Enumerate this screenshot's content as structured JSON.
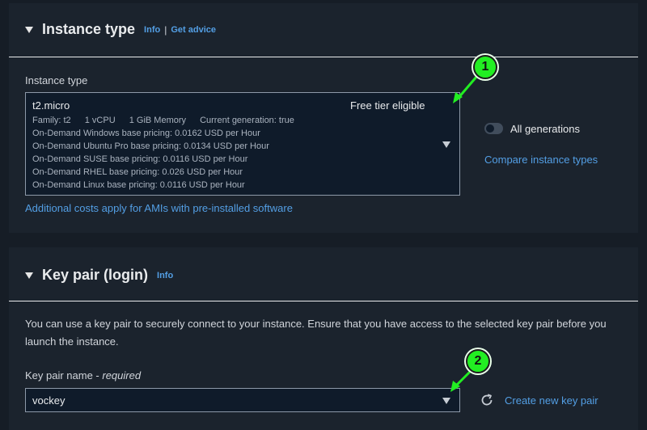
{
  "instance_section": {
    "title": "Instance type",
    "info_link": "Info",
    "separator": "|",
    "advice_link": "Get advice",
    "field_label": "Instance type",
    "selected": {
      "name": "t2.micro",
      "free_tier": "Free tier eligible",
      "family": "Family: t2",
      "vcpu": "1 vCPU",
      "memory": "1 GiB Memory",
      "generation": "Current generation: true",
      "pricing": [
        "On-Demand Windows base pricing: 0.0162 USD per Hour",
        "On-Demand Ubuntu Pro base pricing: 0.0134 USD per Hour",
        "On-Demand SUSE base pricing: 0.0116 USD per Hour",
        "On-Demand RHEL base pricing: 0.026 USD per Hour",
        "On-Demand Linux base pricing: 0.0116 USD per Hour"
      ]
    },
    "toggle_label": "All generations",
    "compare_link": "Compare instance types",
    "ami_costs_link": "Additional costs apply for AMIs with pre-installed software"
  },
  "keypair_section": {
    "title": "Key pair (login)",
    "info_link": "Info",
    "description": "You can use a key pair to securely connect to your instance. Ensure that you have access to the selected key pair before you launch the instance.",
    "field_label": "Key pair name - ",
    "field_required": "required",
    "selected_value": "vockey",
    "create_link": "Create new key pair"
  },
  "annotations": {
    "badge_1": "1",
    "badge_2": "2",
    "color": "#22ee22"
  },
  "colors": {
    "background": "#161d26",
    "panel": "#1b232d",
    "link": "#539fe5",
    "input_bg": "#0f1b2a"
  },
  "icons": {
    "section_caret": "caret-down-icon",
    "dropdown": "triangle-down-icon",
    "refresh": "refresh-icon"
  }
}
